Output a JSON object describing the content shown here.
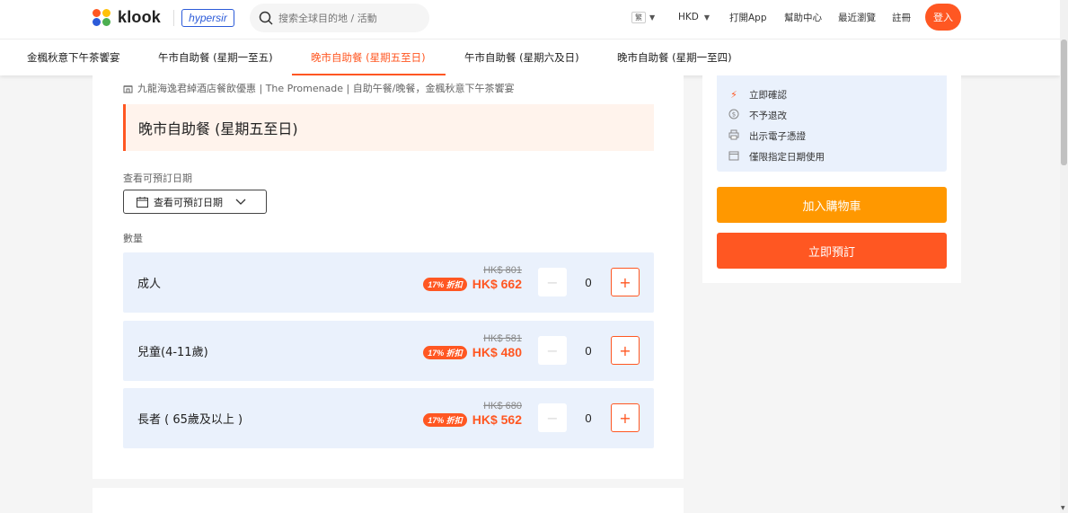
{
  "header": {
    "logo_text": "klook",
    "partner_logo": "hypersir",
    "search_placeholder": "搜索全球目的地 / 活動",
    "lang_label": "繁",
    "currency": "HKD",
    "open_app": "打開App",
    "help_center": "幫助中心",
    "recently_viewed": "最近瀏覽",
    "signup": "註冊",
    "login": "登入"
  },
  "tabs": [
    {
      "label": "金楓秋意下午茶饗宴",
      "active": false
    },
    {
      "label": "午市自助餐 (星期一至五)",
      "active": false
    },
    {
      "label": "晚市自助餐 (星期五至日)",
      "active": true
    },
    {
      "label": "午市自助餐 (星期六及日)",
      "active": false
    },
    {
      "label": "晚市自助餐 (星期一至四)",
      "active": false
    }
  ],
  "main": {
    "breadcrumb": "九龍海逸君綽酒店餐飲優惠 | The Promenade | 自助午餐/晚餐，金楓秋意下午茶饗宴",
    "package_title": "晚市自助餐 (星期五至日)",
    "date_label": "查看可預訂日期",
    "date_button": "查看可預訂日期",
    "quantity_label": "數量",
    "rows": [
      {
        "label": "成人",
        "old_price": "HK$ 801",
        "discount": "17% 折扣",
        "new_price": "HK$ 662",
        "qty": "0"
      },
      {
        "label": "兒童(4-11歲)",
        "old_price": "HK$ 581",
        "discount": "17% 折扣",
        "new_price": "HK$ 480",
        "qty": "0"
      },
      {
        "label": "長者 ( 65歲及以上 )",
        "old_price": "HK$ 680",
        "discount": "17% 折扣",
        "new_price": "HK$ 562",
        "qty": "0"
      }
    ]
  },
  "sidebar": {
    "features": [
      {
        "icon": "bolt-icon",
        "text": "立即確認"
      },
      {
        "icon": "dollar-icon",
        "text": "不予退改"
      },
      {
        "icon": "printer-icon",
        "text": "出示電子憑證"
      },
      {
        "icon": "calendar-icon",
        "text": "僅限指定日期使用"
      }
    ],
    "add_to_cart": "加入購物車",
    "book_now": "立即預訂"
  },
  "colors": {
    "brand": "#ff5722",
    "cart": "#ff9800",
    "row_bg": "#eaf1fc",
    "title_bg": "#fff3ec"
  }
}
